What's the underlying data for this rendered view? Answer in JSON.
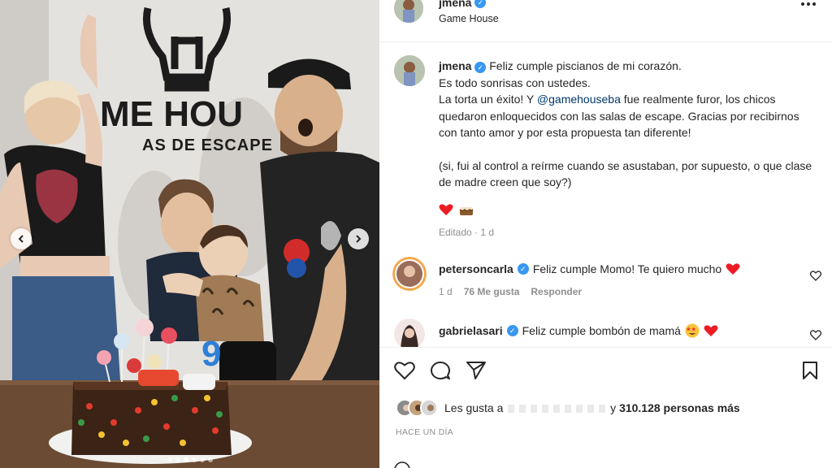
{
  "photo": {
    "sign_main": "ME HOU",
    "sign_sub": "AS DE ESCAPE",
    "cake_number": "9",
    "slides": 6,
    "active_slide": 2
  },
  "post_header": {
    "username": "jmena",
    "location": "Game House"
  },
  "caption": {
    "username": "jmena",
    "line1": "Feliz cumple piscianos de mi corazón.",
    "line2": "Es todo sonrisas con ustedes.",
    "line3_pre": "La torta un éxito! Y ",
    "mention": "@gamehouseba",
    "line3_post": " fue realmente furor, los chicos quedaron enloquecidos con las salas de escape. Gracias por recibirnos con tanto amor y por esta propuesta tan diferente!",
    "line4": "(si, fui al control a reírme cuando se asustaban, por supuesto, o que clase de madre creen que soy?)",
    "meta": "Editado · 1 d"
  },
  "comments": [
    {
      "username": "petersoncarla",
      "text": "Feliz cumple Momo! Te quiero mucho",
      "time": "1 d",
      "likes": "76 Me gusta",
      "reply": "Responder"
    },
    {
      "username": "gabrielasari",
      "text": "Feliz cumple bombón de mamá"
    }
  ],
  "likes_summary": {
    "prefix": "Les gusta a",
    "suffix": "y",
    "count": "310.128 personas más"
  },
  "time_ago": "HACE UN DÍA",
  "colors": {
    "verified": "#3897f0",
    "mention": "#00376b",
    "heart_red": "#ed1c24",
    "muted": "#8e8e8e"
  }
}
